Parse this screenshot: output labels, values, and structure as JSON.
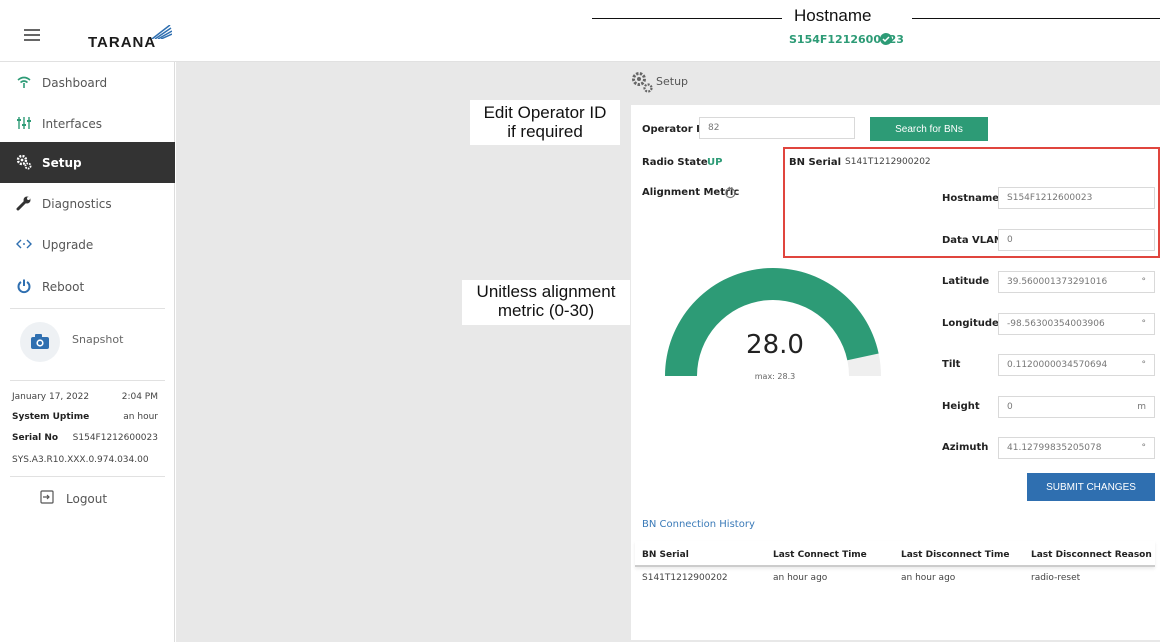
{
  "header": {
    "logo": "TARANA",
    "hostname_title": "Hostname",
    "hostname_value": "S154F1212600023"
  },
  "sidebar": {
    "items": [
      {
        "label": "Dashboard",
        "icon": "wifi-icon"
      },
      {
        "label": "Interfaces",
        "icon": "sliders-icon"
      },
      {
        "label": "Setup",
        "icon": "gears-icon"
      },
      {
        "label": "Diagnostics",
        "icon": "wrench-icon"
      },
      {
        "label": "Upgrade",
        "icon": "code-arrows-icon"
      },
      {
        "label": "Reboot",
        "icon": "power-icon"
      }
    ],
    "snapshot": "Snapshot",
    "date": "January 17, 2022",
    "time": "2:04 PM",
    "uptime_label": "System Uptime",
    "uptime_value": "an hour",
    "serial_label": "Serial No",
    "serial_value": "S154F1212600023",
    "version": "SYS.A3.R10.XXX.0.974.034.00",
    "logout": "Logout"
  },
  "main": {
    "title": "Setup",
    "operator_label": "Operator ID",
    "operator_value": "82",
    "search_button": "Search for BNs",
    "radio_state_label": "Radio State",
    "radio_state_value": "UP",
    "bn_serial_label": "BN Serial",
    "bn_serial_value": "S141T1212900202",
    "alignment_label": "Alignment Metric",
    "hostname_label": "Hostname",
    "hostname_value": "S154F1212600023",
    "vlan_label": "Data VLAN",
    "vlan_value": "0",
    "gauge": {
      "value": "28.0",
      "max_text": "max: 28.3",
      "level": 28.0,
      "max": 30
    },
    "fields": [
      {
        "label": "Latitude",
        "value": "39.560001373291016",
        "unit": "°"
      },
      {
        "label": "Longitude",
        "value": "-98.56300354003906",
        "unit": "°"
      },
      {
        "label": "Tilt",
        "value": "0.1120000034570694",
        "unit": "°"
      },
      {
        "label": "Height",
        "value": "0",
        "unit": "m"
      },
      {
        "label": "Azimuth",
        "value": "41.12799835205078",
        "unit": "°"
      }
    ],
    "submit_button": "SUBMIT CHANGES",
    "history_title": "BN Connection History",
    "history_headers": [
      "BN Serial",
      "Last Connect Time",
      "Last Disconnect Time",
      "Last Disconnect Reason"
    ],
    "history_rows": [
      [
        "S141T1212900202",
        "an hour ago",
        "an hour ago",
        "radio-reset"
      ]
    ]
  },
  "annotations": {
    "operator_note_line1": "Edit Operator ID",
    "operator_note_line2": "if required",
    "metric_note_line1": "Unitless alignment",
    "metric_note_line2": "metric (0-30)"
  },
  "colors": {
    "accent_green": "#2d9b76",
    "accent_blue": "#2f6fb0",
    "highlight_red": "#e0453e",
    "active_nav": "#333333"
  }
}
